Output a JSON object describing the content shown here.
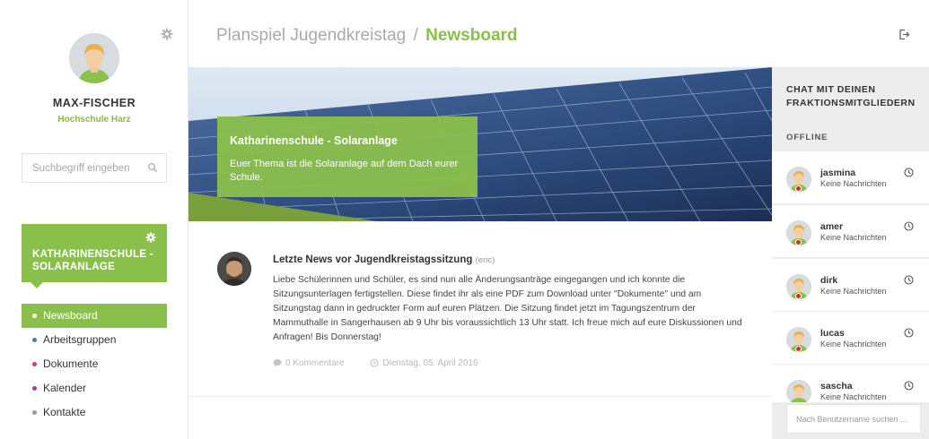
{
  "header": {
    "title_prefix": "Planspiel Jugendkreistag",
    "separator": "/",
    "title_current": "Newsboard"
  },
  "user": {
    "name": "MAX-FISCHER",
    "school": "Hochschule Harz"
  },
  "search": {
    "placeholder": "Suchbegriff eingeben"
  },
  "group": {
    "title": "KATHARINENSCHULE - SOLARANLAGE"
  },
  "nav": {
    "items": [
      {
        "label": "Newsboard",
        "color": "#ffffff",
        "active": true
      },
      {
        "label": "Arbeitsgruppen",
        "color": "#3d7fc2"
      },
      {
        "label": "Dokumente",
        "color": "#e0306e"
      },
      {
        "label": "Kalender",
        "color": "#a23d95"
      },
      {
        "label": "Kontakte",
        "color": "#9a9a9a"
      }
    ]
  },
  "banner": {
    "title": "Katharinenschule - Solaranlage",
    "text": "Euer Thema ist die Solaranlage auf dem Dach eurer Schule."
  },
  "post": {
    "title": "Letzte News vor Jugendkreistagssitzung",
    "author": "(eric)",
    "body": "Liebe Schülerinnen und Schüler, es sind nun alle Änderungsanträge eingegangen und ich konnte die Sitzungsunterlagen fertigstellen. Diese findet ihr als eine PDF zum Download unter \"Dokumente\" und am Sitzungstag dann in gedruckter Form auf euren Plätzen. Die Sitzung findet jetzt im Tagungszentrum der Mammuthalle in Sangerhausen ab 9 Uhr bis voraussichtlich 13 Uhr statt. Ich freue mich auf eure Diskussionen und Anfragen! Bis Donnerstag!",
    "comments": "0 Kommentare",
    "date": "Dienstag, 05. April 2016"
  },
  "chat": {
    "title": "CHAT MIT DEINEN FRAKTIONSMITGLIEDERN",
    "offline_label": "OFFLINE",
    "users": [
      {
        "name": "jasmina",
        "status_text": "Keine Nachrichten"
      },
      {
        "name": "amer",
        "status_text": "Keine Nachrichten"
      },
      {
        "name": "dirk",
        "status_text": "Keine Nachrichten"
      },
      {
        "name": "lucas",
        "status_text": "Keine Nachrichten"
      },
      {
        "name": "sascha",
        "status_text": "Keine Nachrichten"
      }
    ],
    "search_placeholder": "Nach Benutzername suchen ..."
  },
  "colors": {
    "accent": "#8bbf4c",
    "offline": "#d52b2b"
  }
}
